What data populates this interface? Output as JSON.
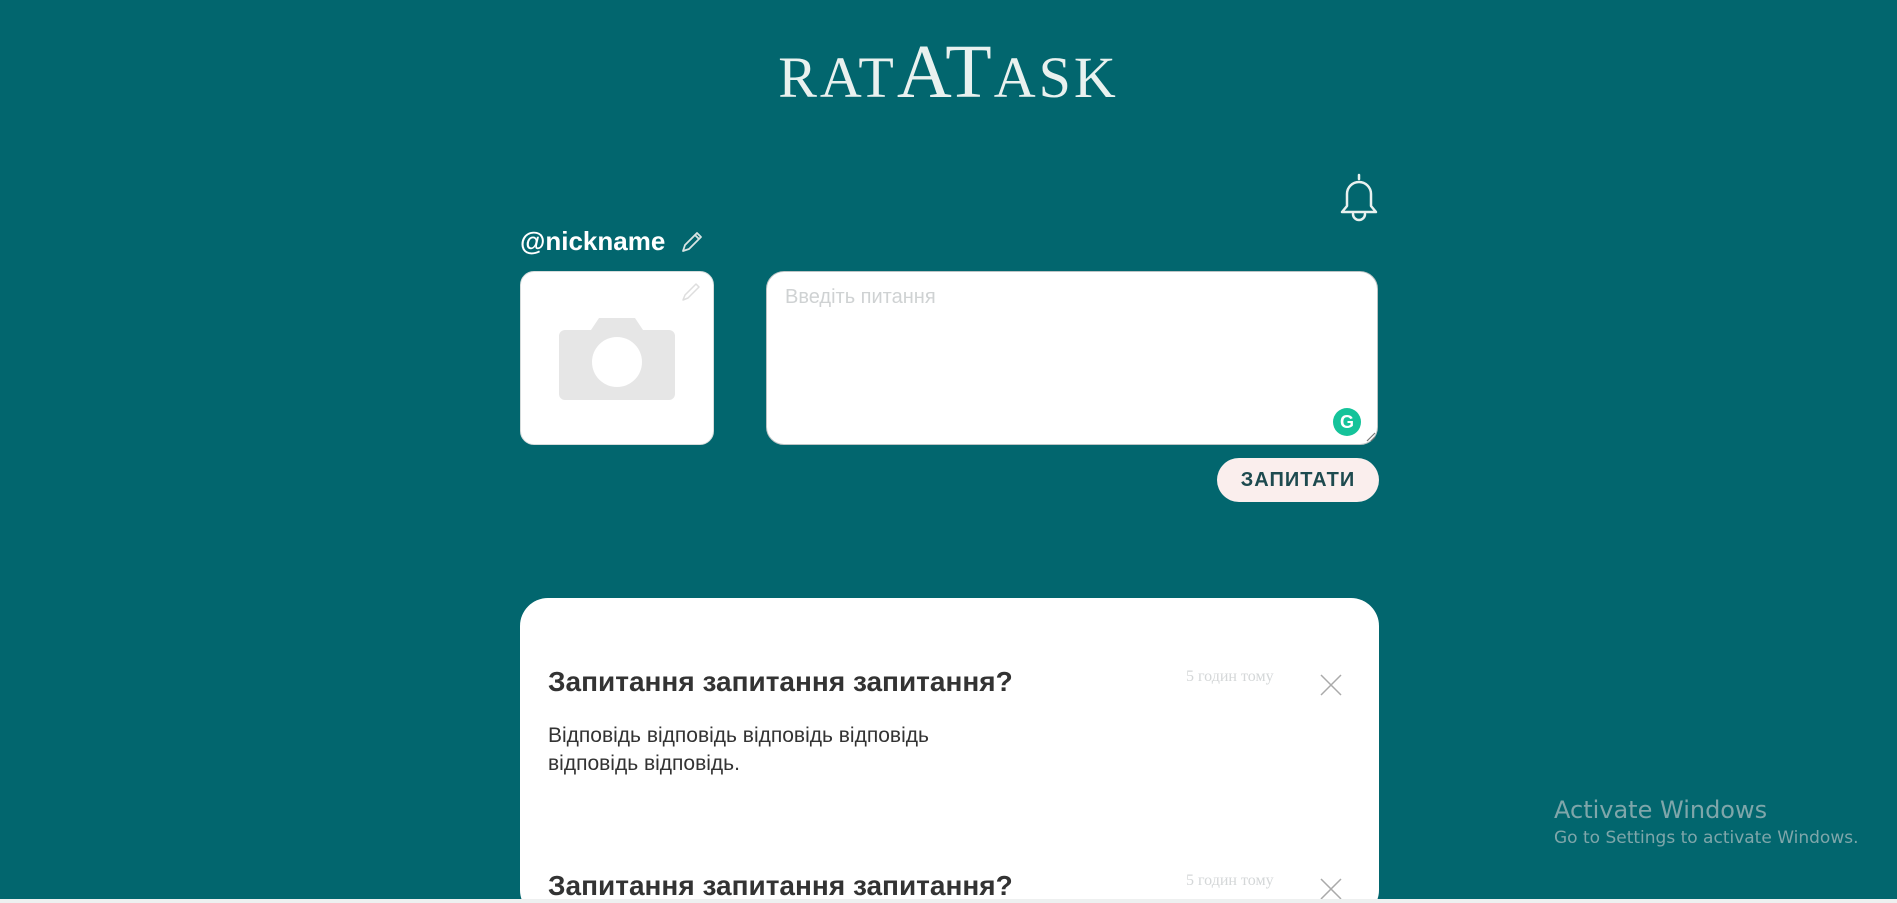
{
  "app": {
    "logo_small_1": "RAT",
    "logo_big": "AT",
    "logo_small_2": "ASK"
  },
  "profile": {
    "nickname": "@nickname"
  },
  "ask_form": {
    "placeholder": "Введіть питання",
    "submit_label": "ЗАПИТАТИ",
    "grammarly_glyph": "G"
  },
  "questions": [
    {
      "title": "Запитання запитання запитання?",
      "time": "5 годин тому",
      "answer": "Відповідь відповідь відповідь відповідь відповідь відповідь."
    },
    {
      "title": "Запитання запитання запитання?",
      "time": "5 годин тому",
      "answer": ""
    }
  ],
  "os_watermark": {
    "title": "Activate Windows",
    "subtitle": "Go to Settings to activate Windows."
  },
  "colors": {
    "background": "#02666e",
    "button_bg": "#faeeed",
    "button_text": "#1d4a4f",
    "grammarly": "#15c39a"
  },
  "icons": [
    "bell-icon",
    "pencil-icon",
    "camera-icon",
    "close-icon",
    "grammarly-icon",
    "resize-handle-icon"
  ]
}
